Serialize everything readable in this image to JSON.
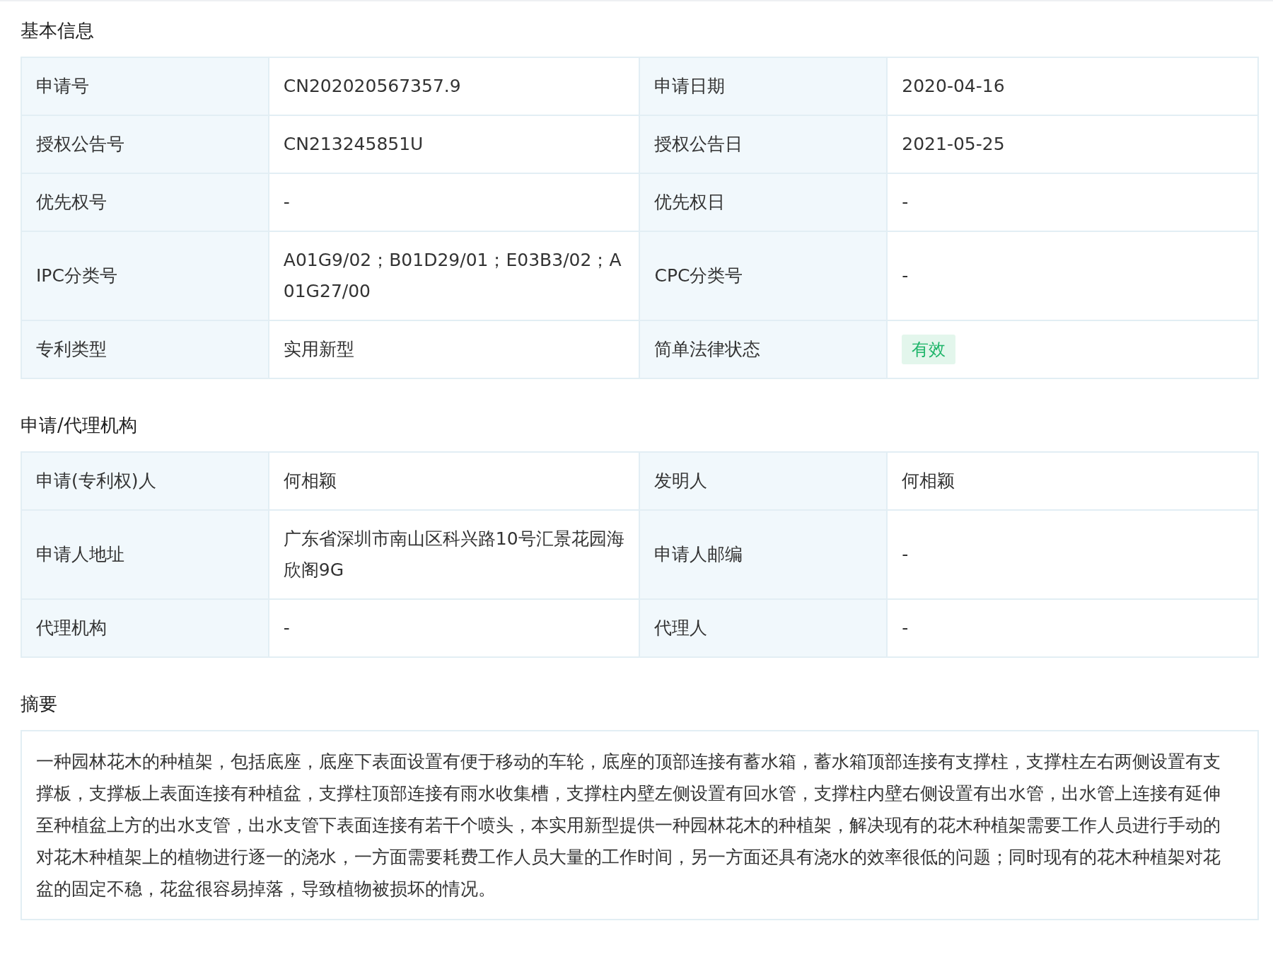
{
  "sections": [
    {
      "title": "基本信息",
      "kind": "table",
      "rows": [
        [
          {
            "label": "申请号",
            "value": "CN202020567357.9",
            "kind": "text"
          },
          {
            "label": "申请日期",
            "value": "2020-04-16",
            "kind": "text"
          }
        ],
        [
          {
            "label": "授权公告号",
            "value": "CN213245851U",
            "kind": "text"
          },
          {
            "label": "授权公告日",
            "value": "2021-05-25",
            "kind": "text"
          }
        ],
        [
          {
            "label": "优先权号",
            "value": "-",
            "kind": "text"
          },
          {
            "label": "优先权日",
            "value": "-",
            "kind": "text"
          }
        ],
        [
          {
            "label": "IPC分类号",
            "value": "A01G9/02；B01D29/01；E03B3/02；A01G27/00",
            "kind": "text"
          },
          {
            "label": "CPC分类号",
            "value": "-",
            "kind": "text"
          }
        ],
        [
          {
            "label": "专利类型",
            "value": "实用新型",
            "kind": "text"
          },
          {
            "label": "简单法律状态",
            "value": "有效",
            "kind": "tag"
          }
        ]
      ]
    },
    {
      "title": "申请/代理机构",
      "kind": "table",
      "rows": [
        [
          {
            "label": "申请(专利权)人",
            "value": "何相颖",
            "kind": "text"
          },
          {
            "label": "发明人",
            "value": "何相颖",
            "kind": "text"
          }
        ],
        [
          {
            "label": "申请人地址",
            "value": "广东省深圳市南山区科兴路10号汇景花园海欣阁9G",
            "kind": "text"
          },
          {
            "label": "申请人邮编",
            "value": "-",
            "kind": "text"
          }
        ],
        [
          {
            "label": "代理机构",
            "value": "-",
            "kind": "text"
          },
          {
            "label": "代理人",
            "value": "-",
            "kind": "text"
          }
        ]
      ]
    },
    {
      "title": "摘要",
      "kind": "text",
      "text": "一种园林花木的种植架，包括底座，底座下表面设置有便于移动的车轮，底座的顶部连接有蓄水箱，蓄水箱顶部连接有支撑柱，支撑柱左右两侧设置有支撑板，支撑板上表面连接有种植盆，支撑柱顶部连接有雨水收集槽，支撑柱内壁左侧设置有回水管，支撑柱内壁右侧设置有出水管，出水管上连接有延伸至种植盆上方的出水支管，出水支管下表面连接有若干个喷头，本实用新型提供一种园林花木的种植架，解决现有的花木种植架需要工作人员进行手动的对花木种植架上的植物进行逐一的浇水，一方面需要耗费工作人员大量的工作时间，另一方面还具有浇水的效率很低的问题；同时现有的花木种植架对花盆的固定不稳，花盆很容易掉落，导致植物被损坏的情况。"
    }
  ]
}
